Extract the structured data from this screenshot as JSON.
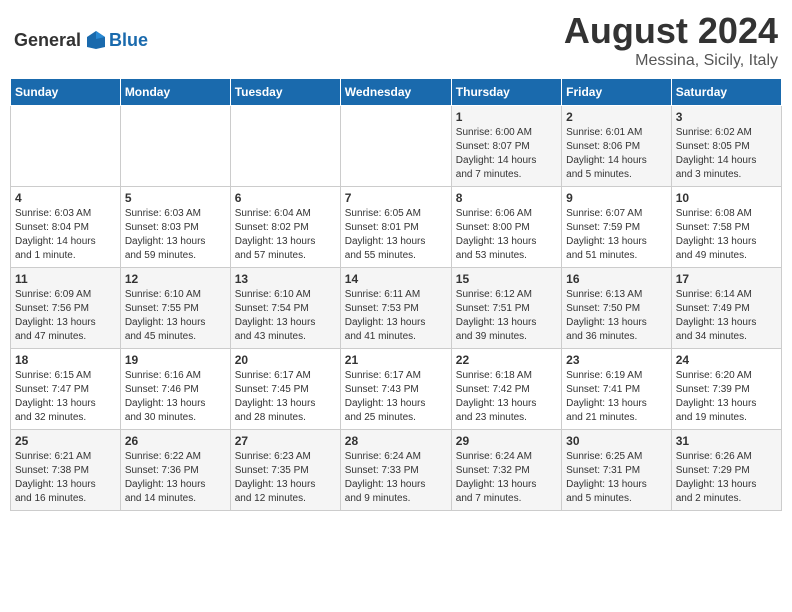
{
  "header": {
    "logo_general": "General",
    "logo_blue": "Blue",
    "month": "August 2024",
    "location": "Messina, Sicily, Italy"
  },
  "weekdays": [
    "Sunday",
    "Monday",
    "Tuesday",
    "Wednesday",
    "Thursday",
    "Friday",
    "Saturday"
  ],
  "weeks": [
    [
      {
        "day": "",
        "info": ""
      },
      {
        "day": "",
        "info": ""
      },
      {
        "day": "",
        "info": ""
      },
      {
        "day": "",
        "info": ""
      },
      {
        "day": "1",
        "info": "Sunrise: 6:00 AM\nSunset: 8:07 PM\nDaylight: 14 hours\nand 7 minutes."
      },
      {
        "day": "2",
        "info": "Sunrise: 6:01 AM\nSunset: 8:06 PM\nDaylight: 14 hours\nand 5 minutes."
      },
      {
        "day": "3",
        "info": "Sunrise: 6:02 AM\nSunset: 8:05 PM\nDaylight: 14 hours\nand 3 minutes."
      }
    ],
    [
      {
        "day": "4",
        "info": "Sunrise: 6:03 AM\nSunset: 8:04 PM\nDaylight: 14 hours\nand 1 minute."
      },
      {
        "day": "5",
        "info": "Sunrise: 6:03 AM\nSunset: 8:03 PM\nDaylight: 13 hours\nand 59 minutes."
      },
      {
        "day": "6",
        "info": "Sunrise: 6:04 AM\nSunset: 8:02 PM\nDaylight: 13 hours\nand 57 minutes."
      },
      {
        "day": "7",
        "info": "Sunrise: 6:05 AM\nSunset: 8:01 PM\nDaylight: 13 hours\nand 55 minutes."
      },
      {
        "day": "8",
        "info": "Sunrise: 6:06 AM\nSunset: 8:00 PM\nDaylight: 13 hours\nand 53 minutes."
      },
      {
        "day": "9",
        "info": "Sunrise: 6:07 AM\nSunset: 7:59 PM\nDaylight: 13 hours\nand 51 minutes."
      },
      {
        "day": "10",
        "info": "Sunrise: 6:08 AM\nSunset: 7:58 PM\nDaylight: 13 hours\nand 49 minutes."
      }
    ],
    [
      {
        "day": "11",
        "info": "Sunrise: 6:09 AM\nSunset: 7:56 PM\nDaylight: 13 hours\nand 47 minutes."
      },
      {
        "day": "12",
        "info": "Sunrise: 6:10 AM\nSunset: 7:55 PM\nDaylight: 13 hours\nand 45 minutes."
      },
      {
        "day": "13",
        "info": "Sunrise: 6:10 AM\nSunset: 7:54 PM\nDaylight: 13 hours\nand 43 minutes."
      },
      {
        "day": "14",
        "info": "Sunrise: 6:11 AM\nSunset: 7:53 PM\nDaylight: 13 hours\nand 41 minutes."
      },
      {
        "day": "15",
        "info": "Sunrise: 6:12 AM\nSunset: 7:51 PM\nDaylight: 13 hours\nand 39 minutes."
      },
      {
        "day": "16",
        "info": "Sunrise: 6:13 AM\nSunset: 7:50 PM\nDaylight: 13 hours\nand 36 minutes."
      },
      {
        "day": "17",
        "info": "Sunrise: 6:14 AM\nSunset: 7:49 PM\nDaylight: 13 hours\nand 34 minutes."
      }
    ],
    [
      {
        "day": "18",
        "info": "Sunrise: 6:15 AM\nSunset: 7:47 PM\nDaylight: 13 hours\nand 32 minutes."
      },
      {
        "day": "19",
        "info": "Sunrise: 6:16 AM\nSunset: 7:46 PM\nDaylight: 13 hours\nand 30 minutes."
      },
      {
        "day": "20",
        "info": "Sunrise: 6:17 AM\nSunset: 7:45 PM\nDaylight: 13 hours\nand 28 minutes."
      },
      {
        "day": "21",
        "info": "Sunrise: 6:17 AM\nSunset: 7:43 PM\nDaylight: 13 hours\nand 25 minutes."
      },
      {
        "day": "22",
        "info": "Sunrise: 6:18 AM\nSunset: 7:42 PM\nDaylight: 13 hours\nand 23 minutes."
      },
      {
        "day": "23",
        "info": "Sunrise: 6:19 AM\nSunset: 7:41 PM\nDaylight: 13 hours\nand 21 minutes."
      },
      {
        "day": "24",
        "info": "Sunrise: 6:20 AM\nSunset: 7:39 PM\nDaylight: 13 hours\nand 19 minutes."
      }
    ],
    [
      {
        "day": "25",
        "info": "Sunrise: 6:21 AM\nSunset: 7:38 PM\nDaylight: 13 hours\nand 16 minutes."
      },
      {
        "day": "26",
        "info": "Sunrise: 6:22 AM\nSunset: 7:36 PM\nDaylight: 13 hours\nand 14 minutes."
      },
      {
        "day": "27",
        "info": "Sunrise: 6:23 AM\nSunset: 7:35 PM\nDaylight: 13 hours\nand 12 minutes."
      },
      {
        "day": "28",
        "info": "Sunrise: 6:24 AM\nSunset: 7:33 PM\nDaylight: 13 hours\nand 9 minutes."
      },
      {
        "day": "29",
        "info": "Sunrise: 6:24 AM\nSunset: 7:32 PM\nDaylight: 13 hours\nand 7 minutes."
      },
      {
        "day": "30",
        "info": "Sunrise: 6:25 AM\nSunset: 7:31 PM\nDaylight: 13 hours\nand 5 minutes."
      },
      {
        "day": "31",
        "info": "Sunrise: 6:26 AM\nSunset: 7:29 PM\nDaylight: 13 hours\nand 2 minutes."
      }
    ]
  ]
}
